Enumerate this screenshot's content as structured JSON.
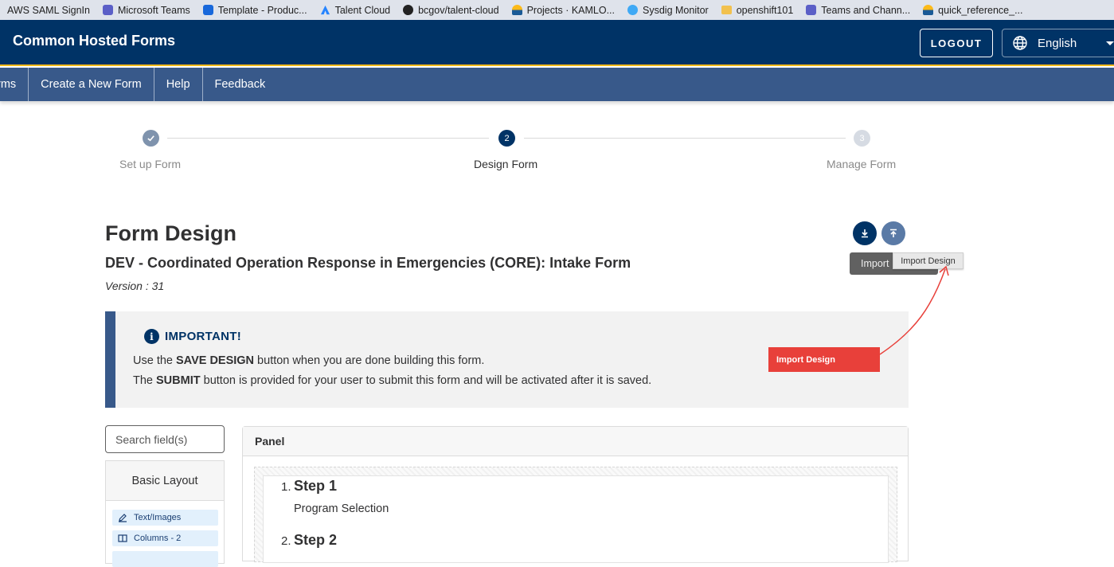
{
  "bookmarks": [
    {
      "label": "AWS SAML SignIn",
      "icon": "aws-icon",
      "color": "#ffffff"
    },
    {
      "label": "Microsoft Teams",
      "icon": "teams-icon",
      "color": "#5b5fc7"
    },
    {
      "label": "Template - Produc...",
      "icon": "confluence-icon",
      "color": "#1868db"
    },
    {
      "label": "Talent Cloud",
      "icon": "atlassian-icon",
      "color": "#2684ff"
    },
    {
      "label": "bcgov/talent-cloud",
      "icon": "github-icon",
      "color": "#222222"
    },
    {
      "label": "Projects · KAMLO...",
      "icon": "bcgov-icon",
      "color": "#fcba19"
    },
    {
      "label": "Sysdig Monitor",
      "icon": "sysdig-icon",
      "color": "#3fa9f5"
    },
    {
      "label": "openshift101",
      "icon": "folder-icon",
      "color": "#f2c14e"
    },
    {
      "label": "Teams and Chann...",
      "icon": "teams-icon",
      "color": "#5b5fc7"
    },
    {
      "label": "quick_reference_...",
      "icon": "bcgov-icon",
      "color": "#fcba19"
    }
  ],
  "header": {
    "title": "Common Hosted Forms",
    "logout_label": "LOGOUT",
    "language": "English"
  },
  "nav": {
    "items": [
      "rms",
      "Create a New Form",
      "Help",
      "Feedback"
    ]
  },
  "stepper": {
    "steps": [
      {
        "number": "1",
        "label": "Set up Form",
        "state": "complete"
      },
      {
        "number": "2",
        "label": "Design Form",
        "state": "active"
      },
      {
        "number": "3",
        "label": "Manage Form",
        "state": "pending"
      }
    ]
  },
  "design": {
    "heading": "Form Design",
    "form_name": "DEV - Coordinated Operation Response in Emergencies (CORE): Intake Form",
    "version": "Version : 31",
    "tooltip_dark": "Import",
    "tooltip_light": "Import Design",
    "callout_label": "Import Design"
  },
  "banner": {
    "title": "IMPORTANT!",
    "line1_pre": "Use the ",
    "line1_bold": "SAVE DESIGN",
    "line1_post": " button when you are done building this form.",
    "line2_pre": "The ",
    "line2_bold": "SUBMIT",
    "line2_post": " button is provided for your user to submit this form and will be activated after it is saved."
  },
  "builder": {
    "search_placeholder": "Search field(s)",
    "group_title": "Basic Layout",
    "components": [
      "Text/Images",
      "Columns - 2"
    ],
    "panel_title": "Panel",
    "steps": [
      {
        "num": "1.",
        "title": "Step 1",
        "desc": "Program Selection"
      },
      {
        "num": "2.",
        "title": "Step 2",
        "desc": ""
      }
    ]
  },
  "colors": {
    "header_bg": "#003366",
    "nav_bg": "#38598a",
    "accent_gold": "#fcba19",
    "callout_red": "#e8403a"
  }
}
